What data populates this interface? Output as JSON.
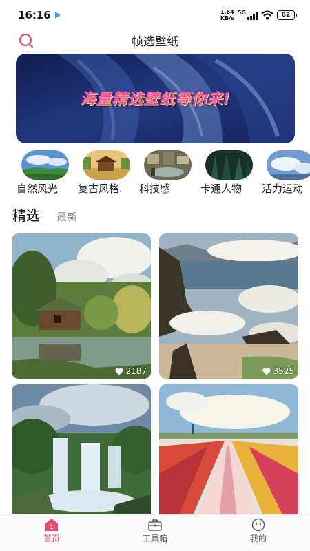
{
  "status_bar": {
    "time": "16:16",
    "net_speed_value": "1.64",
    "net_speed_unit": "KB/s",
    "network": "5G",
    "battery": "62"
  },
  "header": {
    "title": "帧选壁纸",
    "search_icon": "search-icon"
  },
  "banner": {
    "text": "海量精选壁纸等你来!"
  },
  "categories": [
    {
      "label": "自然风光"
    },
    {
      "label": "复古风格"
    },
    {
      "label": "科技感"
    },
    {
      "label": "卡通人物"
    },
    {
      "label": "活力运动"
    }
  ],
  "tabs": {
    "featured": "精选",
    "latest": "最新"
  },
  "wallpapers": [
    {
      "likes": "2187"
    },
    {
      "likes": "3525"
    },
    {
      "likes": ""
    },
    {
      "likes": ""
    }
  ],
  "bottom_nav": {
    "home": "首页",
    "home_badge": "1",
    "toolbox": "工具箱",
    "mine": "我的"
  },
  "colors": {
    "accent": "#e34d6c",
    "banner_bg": "#1e2f6e"
  }
}
